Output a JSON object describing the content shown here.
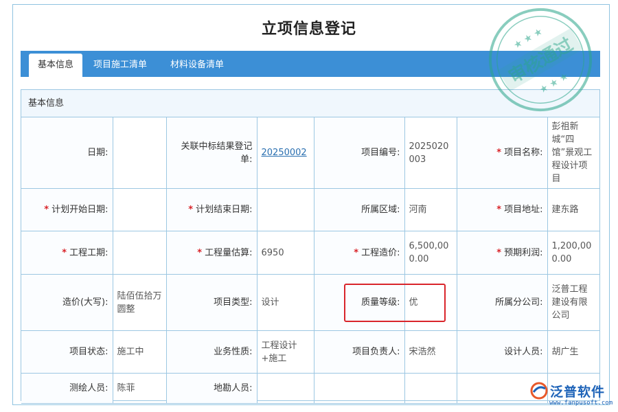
{
  "page": {
    "title": "立项信息登记"
  },
  "tabs": [
    {
      "label": "基本信息",
      "active": true
    },
    {
      "label": "项目施工清单",
      "active": false
    },
    {
      "label": "材料设备清单",
      "active": false
    }
  ],
  "panel": {
    "title": "基本信息"
  },
  "fields": {
    "date": {
      "label": "日期:",
      "value": ""
    },
    "bid_result": {
      "label": "关联中标结果登记单:",
      "value": "20250002"
    },
    "project_no": {
      "label": "项目编号:",
      "value": "2025020003"
    },
    "project_name": {
      "label": "项目名称:",
      "value": "彭祖新城“四馆”景观工程设计项目",
      "required": true
    },
    "plan_start": {
      "label": "计划开始日期:",
      "value": "",
      "required": true
    },
    "plan_end": {
      "label": "计划结束日期:",
      "value": "",
      "required": true
    },
    "region": {
      "label": "所属区域:",
      "value": "河南"
    },
    "address": {
      "label": "项目地址:",
      "value": "建东路",
      "required": true
    },
    "duration": {
      "label": "工程工期:",
      "value": "",
      "required": true
    },
    "quantity": {
      "label": "工程量估算:",
      "value": "6950",
      "required": true
    },
    "cost": {
      "label": "工程造价:",
      "value": "6,500,000.00",
      "required": true
    },
    "profit": {
      "label": "预期利润:",
      "value": "1,200,000.00",
      "required": true
    },
    "cost_cn": {
      "label": "造价(大写):",
      "value": "陆佰伍拾万圆整"
    },
    "project_type": {
      "label": "项目类型:",
      "value": "设计"
    },
    "quality": {
      "label": "质量等级:",
      "value": "优"
    },
    "branch": {
      "label": "所属分公司:",
      "value": "泛普工程建设有限公司"
    },
    "status": {
      "label": "项目状态:",
      "value": "施工中"
    },
    "business": {
      "label": "业务性质:",
      "value": "工程设计+施工"
    },
    "manager": {
      "label": "项目负责人:",
      "value": "宋浩然"
    },
    "designer": {
      "label": "设计人员:",
      "value": "胡广生"
    },
    "surveyor": {
      "label": "测绘人员:",
      "value": "陈菲"
    },
    "explorer": {
      "label": "地勘人员:",
      "value": ""
    }
  },
  "stamp": {
    "text": "审核通过"
  },
  "brand": {
    "name": "泛普软件",
    "url": "www.fanpusoft.com"
  },
  "colors": {
    "accent": "#3c8fd6",
    "required": "#d9242a",
    "stamp": "#2aa58a",
    "brand": "#1e63b8"
  }
}
